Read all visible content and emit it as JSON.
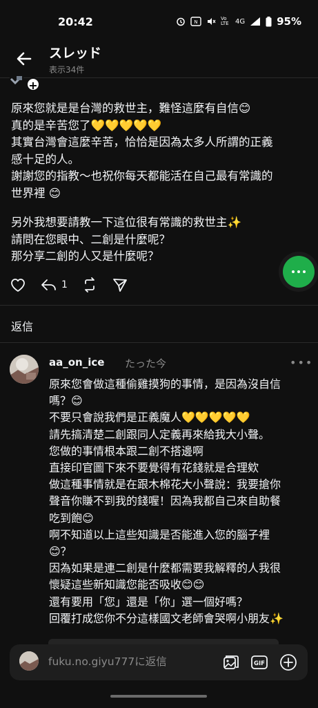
{
  "status_bar": {
    "time": "20:42",
    "battery": "95%",
    "network": "4G",
    "volte": "Vo LTE"
  },
  "header": {
    "title": "スレッド",
    "subtitle": "表示34件"
  },
  "post": {
    "paragraphs": [
      [
        "原來您就是是台灣的救世主，難怪這麼有自信😊",
        "真的是辛苦您了💛💛💛💛💛",
        "其實台灣會這麼辛苦，恰恰是因為太多人所謂的正義",
        "感十足的人。",
        "謝謝您的指教～也祝你每天都能活在自己最有常識的",
        "世界裡 😊"
      ],
      [
        "另外我想要請教一下這位很有常識的救世主✨",
        "請問在您眼中、二創是什麼呢？",
        "那分享二創的人又是什麼呢？"
      ]
    ],
    "actions": {
      "repost_count": "1"
    }
  },
  "replies_heading": "返信",
  "comment": {
    "username": "aa_on_ice",
    "time": "たった今",
    "lines": [
      "原來您會做這種偷雞摸狗的事情，是因為沒自信",
      "嗎？😊",
      "不要只會說我們是正義魔人💛💛💛💛💛",
      "請先搞清楚二創跟同人定義再來給我大小聲。",
      "您做的事情根本跟二創不搭邊啊",
      "直接印官圖下來不要覺得有花錢就是合理欸",
      "做這種事情就是在跟木棉花大小聲說：我要搶你",
      "聲音你賺不到我的錢喔！因為我都自己來自助餐",
      "吃到飽😊",
      "啊不知道以上這些知識是否能進入您的腦子裡",
      "😊？",
      "因為如果是連二創是什麼都需要我解釋的人我很",
      "懷疑這些新知識您能否吸收😊😊",
      "還有要用「您」還是「你」選一個好嗎？",
      "回覆打成您你不分這樣國文老師會哭啊小朋友✨"
    ]
  },
  "composer": {
    "placeholder": "fuku.no.giyu777に返信"
  },
  "colors": {
    "background": "#101010",
    "fab": "#1fae4a",
    "muted": "#8a8a8a"
  }
}
